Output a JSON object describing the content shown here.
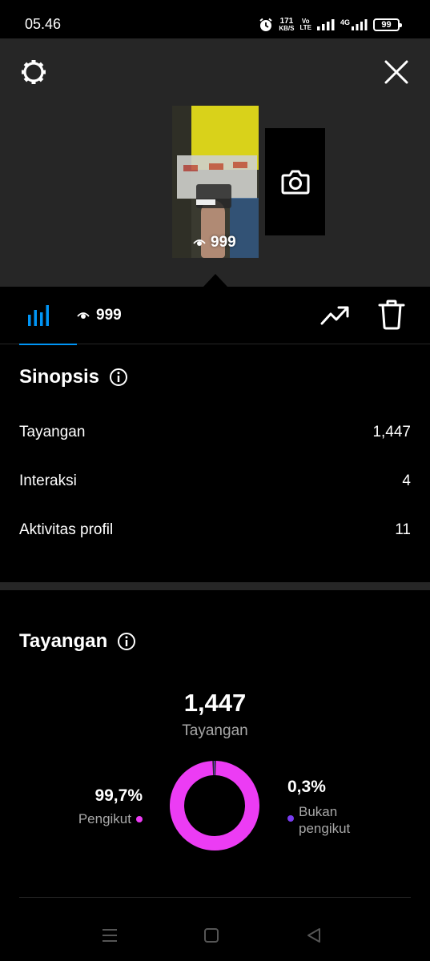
{
  "status_bar": {
    "time": "05.46",
    "speed_value": "171",
    "speed_unit": "KB/S",
    "volte_top": "Vo",
    "volte_bottom": "LTE",
    "network": "4G",
    "battery": "99"
  },
  "story": {
    "view_count": "999",
    "settings_icon": "gear-icon",
    "close_icon": "close-icon",
    "add_icon": "camera-icon"
  },
  "tabs": {
    "insights_icon": "bar-chart-icon",
    "views_count": "999",
    "trend_icon": "trending-up-icon",
    "delete_icon": "trash-icon"
  },
  "overview": {
    "title": "Sinopsis",
    "rows": [
      {
        "label": "Tayangan",
        "value": "1,447"
      },
      {
        "label": "Interaksi",
        "value": "4"
      },
      {
        "label": "Aktivitas profil",
        "value": "11"
      }
    ]
  },
  "views": {
    "title": "Tayangan",
    "total": "1,447",
    "total_label": "Tayangan",
    "followers_pct": "99,7%",
    "followers_label": "Pengikut",
    "non_followers_pct": "0,3%",
    "non_followers_label_1": "Bukan",
    "non_followers_label_2": "pengikut",
    "followers_fraction": 0.997,
    "colors": {
      "followers": "#ec3cf4",
      "non_followers": "#7a3cf0"
    }
  },
  "colors": {
    "accent": "#0095f6",
    "panel": "#262626",
    "muted": "#a8a8a8"
  }
}
